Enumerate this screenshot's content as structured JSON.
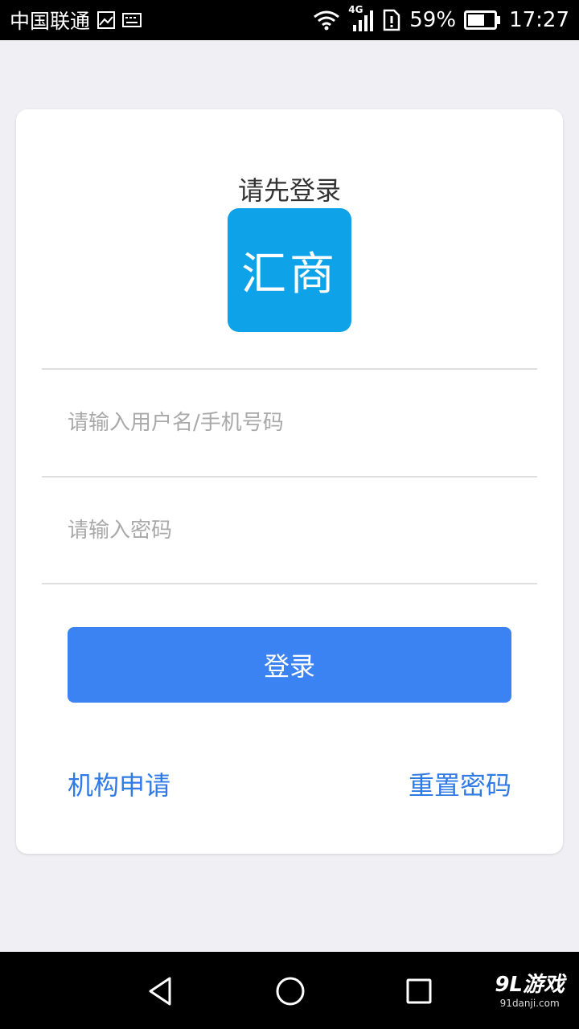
{
  "status_bar": {
    "carrier": "中国联通",
    "network": "4G",
    "battery": "59%",
    "time": "17:27",
    "icons": [
      "image-icon",
      "keyboard-icon",
      "wifi-icon",
      "signal-icon",
      "sim-alert-icon",
      "battery-icon"
    ]
  },
  "login": {
    "title": "请先登录",
    "logo_text": "汇商",
    "username_placeholder": "请输入用户名/手机号码",
    "password_placeholder": "请输入密码",
    "login_button": "登录",
    "apply_link": "机构申请",
    "reset_link": "重置密码"
  },
  "colors": {
    "accent": "#3b83f2",
    "link": "#2f7ae5",
    "logo_bg": "#0ea2e8",
    "page_bg": "#efeff4"
  },
  "nav_bar": {
    "icons": [
      "back-icon",
      "home-icon",
      "recents-icon"
    ]
  },
  "watermark": {
    "main": "9L游戏",
    "sub": "91danji.com"
  }
}
